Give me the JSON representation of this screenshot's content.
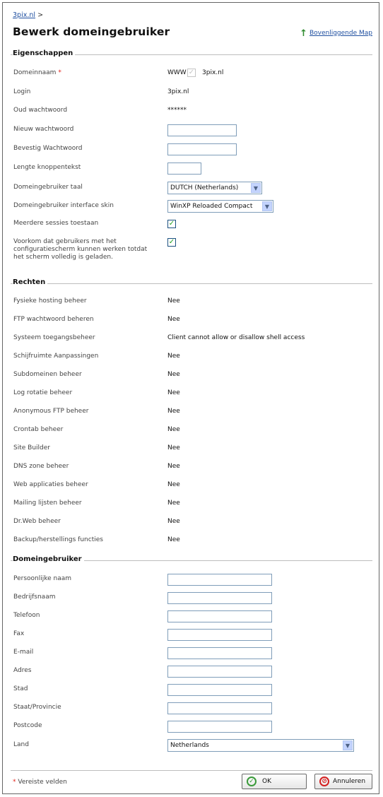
{
  "breadcrumb": {
    "link": "3pix.nl",
    "sep": ">"
  },
  "page_title": "Bewerk domeingebruiker",
  "up_link": "Bovenliggende Map",
  "required_mark": "*",
  "sections": {
    "properties": "Eigenschappen",
    "rights": "Rechten",
    "domain_user": "Domeingebruiker"
  },
  "properties": {
    "domain_name_label": "Domeinnaam",
    "domain_prefix": "WWW",
    "domain_value": "3pix.nl",
    "login_label": "Login",
    "login_value": "3pix.nl",
    "old_password_label": "Oud wachtwoord",
    "old_password_value": "******",
    "new_password_label": "Nieuw wachtwoord",
    "confirm_password_label": "Bevestig Wachtwoord",
    "button_text_length_label": "Lengte knoppentekst",
    "language_label": "Domeingebruiker taal",
    "language_value": "DUTCH (Netherlands)",
    "skin_label": "Domeingebruiker interface skin",
    "skin_value": "WinXP Reloaded Compact",
    "multi_sessions_label": "Meerdere sessies toestaan",
    "prevent_label_1": "Voorkom dat gebruikers met het",
    "prevent_label_2": "configuratiescherm kunnen werken totdat",
    "prevent_label_3": "het scherm volledig is geladen."
  },
  "rights": [
    {
      "label": "Fysieke hosting beheer",
      "value": "Nee"
    },
    {
      "label": "FTP wachtwoord beheren",
      "value": "Nee"
    },
    {
      "label": "Systeem toegangsbeheer",
      "value": "Client cannot allow or disallow shell access"
    },
    {
      "label": "Schijfruimte Aanpassingen",
      "value": "Nee"
    },
    {
      "label": "Subdomeinen beheer",
      "value": "Nee"
    },
    {
      "label": "Log rotatie beheer",
      "value": "Nee"
    },
    {
      "label": "Anonymous FTP beheer",
      "value": "Nee"
    },
    {
      "label": "Crontab beheer",
      "value": "Nee"
    },
    {
      "label": "Site Builder",
      "value": "Nee"
    },
    {
      "label": "DNS zone beheer",
      "value": "Nee"
    },
    {
      "label": "Web applicaties beheer",
      "value": "Nee"
    },
    {
      "label": "Mailing lijsten beheer",
      "value": "Nee"
    },
    {
      "label": "Dr.Web beheer",
      "value": "Nee"
    },
    {
      "label": "Backup/herstellings functies",
      "value": "Nee"
    }
  ],
  "domain_user": {
    "personal_name": "Persoonlijke naam",
    "company": "Bedrijfsnaam",
    "phone": "Telefoon",
    "fax": "Fax",
    "email": "E-mail",
    "address": "Adres",
    "city": "Stad",
    "state": "Staat/Provincie",
    "zip": "Postcode",
    "country": "Land",
    "country_value": "Netherlands"
  },
  "footer": {
    "required_fields": "Vereiste velden",
    "ok": "OK",
    "cancel": "Annuleren"
  }
}
